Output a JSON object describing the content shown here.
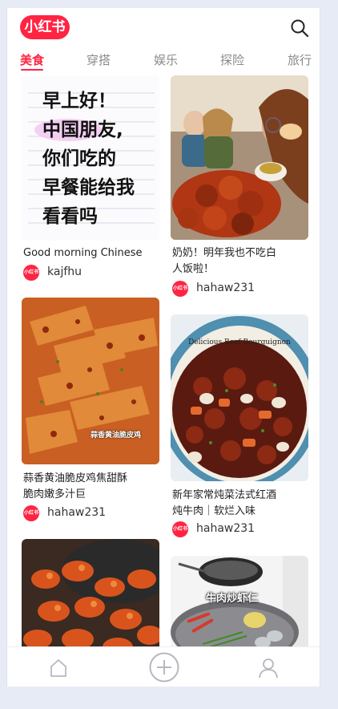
{
  "app": {
    "logo_text": "小红书"
  },
  "tabs": [
    {
      "label": "美食",
      "active": true
    },
    {
      "label": "穿搭"
    },
    {
      "label": "娱乐"
    },
    {
      "label": "探险"
    },
    {
      "label": "旅行"
    }
  ],
  "cards": [
    {
      "title": "Good morning Chinese",
      "author": "kajfhu",
      "image_text": [
        "早上好！",
        "中国朋友,",
        "你们吃的",
        "早餐能给我",
        "看看吗"
      ]
    },
    {
      "title_lines": [
        "奶奶！明年我也不吃白",
        "人饭啦！"
      ],
      "author": "hahaw231"
    },
    {
      "title_lines": [
        "蒜香黄油脆皮鸡焦甜酥",
        "脆肉嫩多汁巨"
      ],
      "author": "hahaw231",
      "image_caption": "蒜香黄油脆皮鸡"
    },
    {
      "title_lines": [
        "新年家常炖菜法式红酒",
        "炖牛肉｜软烂入味"
      ],
      "author": "hahaw231",
      "image_caption": "Delicious Beef Bourguignon"
    },
    {
      "author": ""
    },
    {
      "image_caption": "牛肉炒虾仁"
    }
  ],
  "avatar_text": "小红书",
  "colors": {
    "brand": "#ff2442",
    "icon": "#b5b8bf"
  },
  "icons": {
    "search": "search-icon",
    "home": "home-icon",
    "add": "plus-circle-icon",
    "profile": "user-icon"
  }
}
